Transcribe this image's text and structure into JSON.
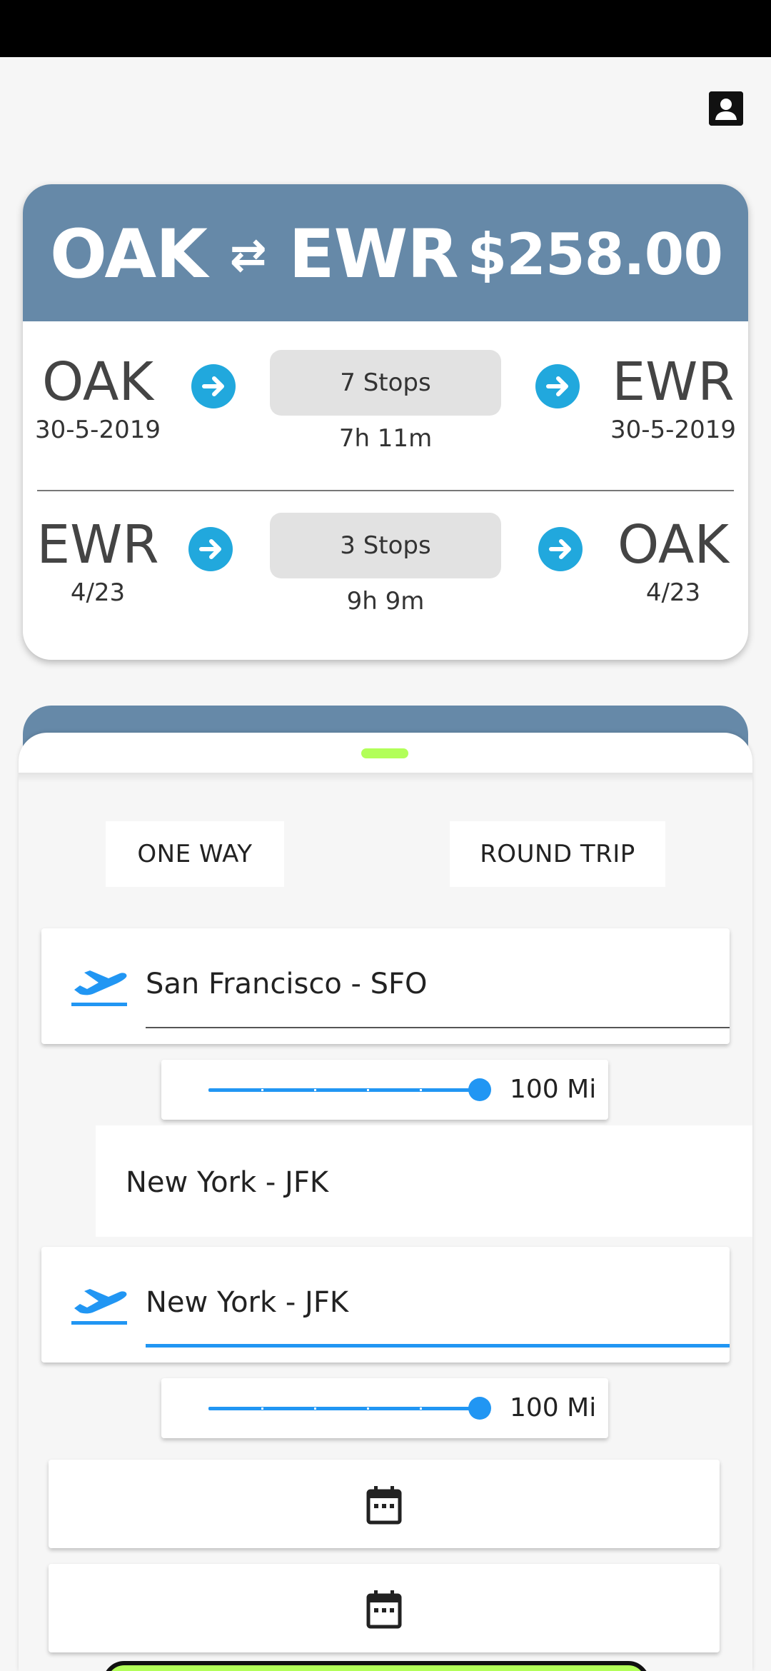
{
  "flight_card": {
    "origin": "OAK",
    "destination": "EWR",
    "title_separator": "⇄",
    "price": "$258.00",
    "legs": [
      {
        "from": "OAK",
        "from_date": "30-5-2019",
        "stops": "7 Stops",
        "duration": "7h 11m",
        "to": "EWR",
        "to_date": "30-5-2019"
      },
      {
        "from": "EWR",
        "from_date": "4/23",
        "stops": "3 Stops",
        "duration": "9h 9m",
        "to": "OAK",
        "to_date": "4/23"
      }
    ]
  },
  "search": {
    "trip_types": {
      "one_way": "ONE WAY",
      "round_trip": "ROUND TRIP"
    },
    "origin_value": "San Francisco - SFO",
    "origin_radius": "100 Mi",
    "suggestion": "New York - JFK",
    "destination_value": "New York - JFK",
    "destination_radius": "100 Mi"
  },
  "icons": {
    "profile": "account-box-icon",
    "arrow": "arrow-right-circle-icon",
    "plane": "flight-takeoff-icon",
    "calendar": "calendar-icon"
  },
  "colors": {
    "header": "#6689a8",
    "accent": "#2196f3",
    "arrow": "#21a8dd",
    "handle": "#b2ff59"
  }
}
